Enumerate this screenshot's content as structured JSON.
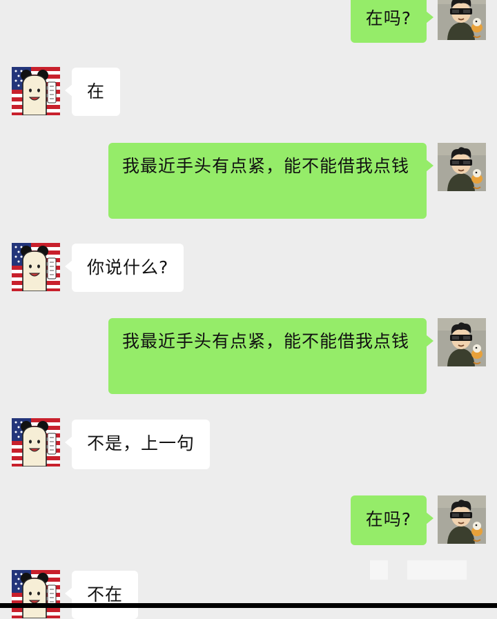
{
  "messages": [
    {
      "side": "out",
      "text": "在吗?"
    },
    {
      "side": "in",
      "text": "在"
    },
    {
      "side": "out",
      "text": "我最近手头有点紧，能不能借我点钱"
    },
    {
      "side": "in",
      "text": "你说什么?"
    },
    {
      "side": "out",
      "text": "我最近手头有点紧，能不能借我点钱"
    },
    {
      "side": "in",
      "text": "不是，上一句"
    },
    {
      "side": "out",
      "text": "在吗?"
    },
    {
      "side": "in",
      "text": "不在"
    }
  ],
  "colors": {
    "background": "#ededed",
    "outgoing_bubble": "#95ec69",
    "incoming_bubble": "#ffffff"
  },
  "avatars": {
    "self": "cartoon-man-sunglasses-avatar-icon",
    "friend": "cartoon-girl-us-flag-avatar-icon"
  }
}
